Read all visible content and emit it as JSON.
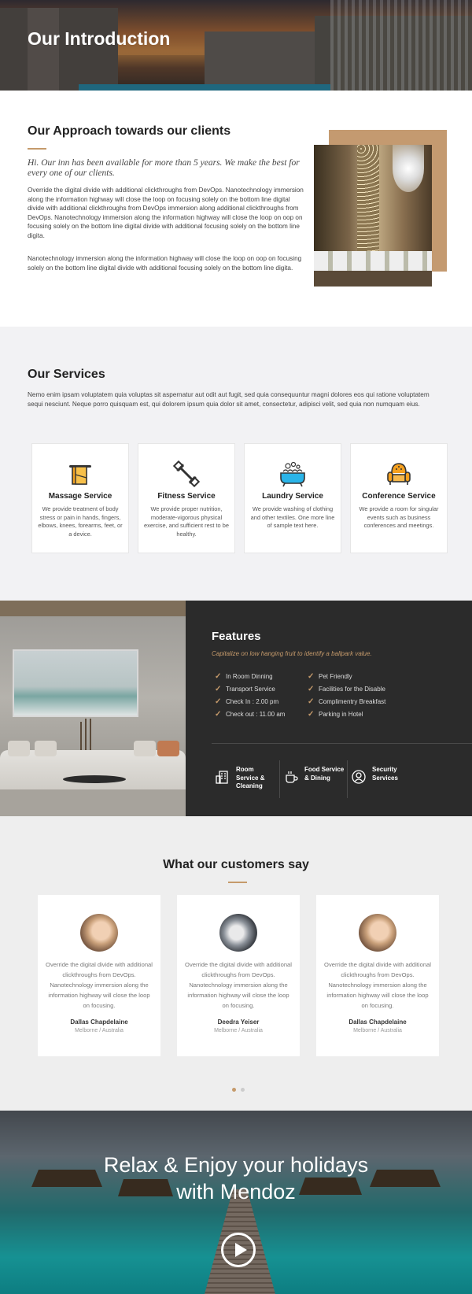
{
  "hero": {
    "title": "Our Introduction"
  },
  "approach": {
    "title": "Our Approach towards our clients",
    "lead": "Hi. Our inn has been available for more than 5 years. We make the best for every one of our clients.",
    "p1": "Override the digital divide with additional clickthroughs from DevOps. Nanotechnology immersion along the information highway will close the loop on focusing solely on the bottom line digital divide with additional clickthroughs from DevOps immersion along additional clickthroughs from DevOps. Nanotechnology immersion along the information highway will close the loop on oop on focusing solely on the bottom line digital divide with additional focusing solely on the bottom line digita.",
    "p2": "Nanotechnology immersion along the information highway will close the loop on oop on focusing solely on the bottom line digital divide with additional focusing solely on the bottom line digita."
  },
  "services": {
    "title": "Our Services",
    "description": "Nemo enim ipsam voluptatem quia voluptas sit aspernatur aut odit aut fugit, sed quia consequuntur magni dolores eos qui ratione voluptatem sequi nesciunt. Neque porro quisquam est, qui dolorem ipsum quia dolor sit amet, consectetur, adipisci velit, sed quia non numquam eius.",
    "items": [
      {
        "icon": "towel-icon",
        "title": "Massage Service",
        "text": "We provide treatment of body stress or pain in hands, fingers, elbows, knees, forearms, feet, or a device."
      },
      {
        "icon": "dumbbell-icon",
        "title": "Fitness Service",
        "text": "We provide proper nutrition, moderate-vigorous physical exercise, and sufficient rest to be healthy."
      },
      {
        "icon": "bathtub-icon",
        "title": "Laundry Service",
        "text": "We provide washing of clothing and other textiles. One more line of sample text here."
      },
      {
        "icon": "armchair-icon",
        "title": "Conference Service",
        "text": "We provide a room for singular events such as business conferences and meetings."
      }
    ]
  },
  "features": {
    "title": "Features",
    "tagline": "Capitalize on low hanging fruit to identify a ballpark value.",
    "col1": [
      "In Room Dinning",
      "Transport Service",
      "Check In : 2.00 pm",
      "Check out : 11.00 am"
    ],
    "col2": [
      "Pet Friendly",
      "Facilities for the Disable",
      "Complimentry Breakfast",
      "Parking in Hotel"
    ],
    "amenities": [
      {
        "icon": "building-icon",
        "label1": "Room",
        "label2": "Service &",
        "label3": "Cleaning"
      },
      {
        "icon": "coffee-cup-icon",
        "label1": "Food Service",
        "label2": "& Dining",
        "label3": ""
      },
      {
        "icon": "security-guard-icon",
        "label1": "Security",
        "label2": "Services",
        "label3": ""
      }
    ],
    "accent": "#c59a6b"
  },
  "testimonials": {
    "title": "What our customers say",
    "items": [
      {
        "quote": "Override the digital divide with additional clickthroughs from DevOps. Nanotechnology immersion along the information highway will close the loop on focusing.",
        "name": "Dallas Chapdelaine",
        "location": "Melborne / Australia"
      },
      {
        "quote": "Override the digital divide with additional clickthroughs from DevOps. Nanotechnology immersion along the information highway will close the loop on focusing.",
        "name": "Deedra Yeiser",
        "location": "Melborne / Australia"
      },
      {
        "quote": "Override the digital divide with additional clickthroughs from DevOps. Nanotechnology immersion along the information highway will close the loop on focusing.",
        "name": "Dallas Chapdelaine",
        "location": "Melborne / Australia"
      }
    ]
  },
  "cta": {
    "line1": "Relax & Enjoy your holidays",
    "line2": "with Mendoz"
  }
}
